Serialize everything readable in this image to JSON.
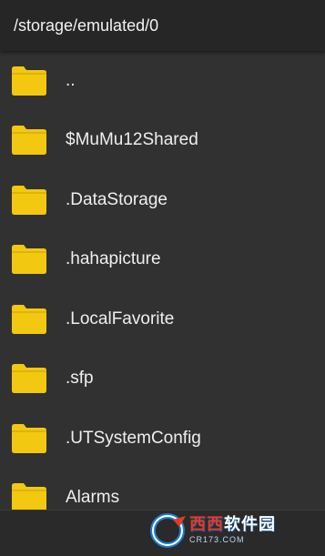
{
  "header": {
    "path": "/storage/emulated/0"
  },
  "files": [
    {
      "name": "..",
      "icon": "folder-icon"
    },
    {
      "name": "$MuMu12Shared",
      "icon": "folder-icon"
    },
    {
      "name": ".DataStorage",
      "icon": "folder-icon"
    },
    {
      "name": ".hahapicture",
      "icon": "folder-icon"
    },
    {
      "name": ".LocalFavorite",
      "icon": "folder-icon"
    },
    {
      "name": ".sfp",
      "icon": "folder-icon"
    },
    {
      "name": ".UTSystemConfig",
      "icon": "folder-icon"
    },
    {
      "name": "Alarms",
      "icon": "folder-icon"
    }
  ],
  "watermark": {
    "accent": "西西",
    "main": "软件园",
    "sub": "CR173.COM"
  },
  "colors": {
    "folder": "#f2c811",
    "folder_dark": "#d9ae00",
    "background": "#313131",
    "header": "#262626"
  }
}
